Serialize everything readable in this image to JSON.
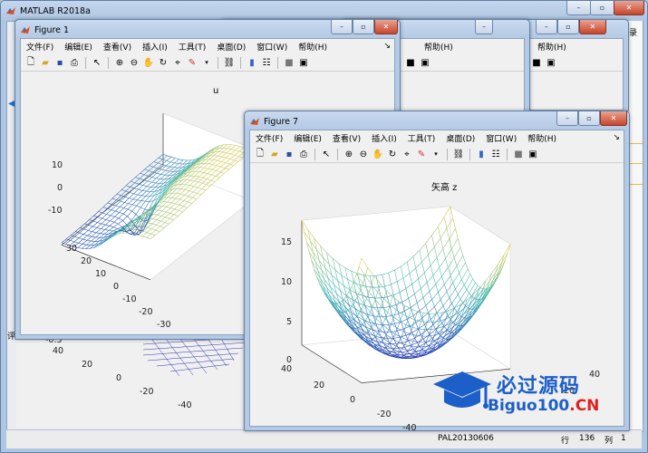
{
  "matlab": {
    "title": "MATLAB R2018a",
    "right_edge_text": "录",
    "status": {
      "pal": "PAL20130606",
      "row_label": "行",
      "row_value": "136",
      "col_label": "列",
      "col_value": "1"
    }
  },
  "bg_figures": {
    "menu_item_help": "帮助(H)"
  },
  "figure1": {
    "title": "Figure 1",
    "menu": [
      "文件(F)",
      "编辑(E)",
      "查看(V)",
      "插入(I)",
      "工具(T)",
      "桌面(D)",
      "窗口(W)",
      "帮助(H)"
    ],
    "plot_title": "u",
    "z_ticks": [
      "10",
      "0",
      "-10"
    ],
    "y_ticks": [
      "30",
      "20",
      "10",
      "0",
      "-10",
      "-20",
      "-30"
    ],
    "x_tick_partial": "-2"
  },
  "behind_plot": {
    "z_ticks": [
      "-0.5"
    ],
    "y_ticks": [
      "40",
      "20",
      "0",
      "-20",
      "-40"
    ],
    "left_edge_text": "评"
  },
  "figure7": {
    "title": "Figure 7",
    "menu": [
      "文件(F)",
      "编辑(E)",
      "查看(V)",
      "插入(I)",
      "工具(T)",
      "桌面(D)",
      "窗口(W)",
      "帮助(H)"
    ],
    "plot_title": "矢高 z",
    "z_ticks": [
      "15",
      "10",
      "5",
      "0"
    ],
    "y_ticks": [
      "40",
      "20",
      "0",
      "-20",
      "-40"
    ],
    "x_ticks": [
      "40",
      "20"
    ]
  },
  "watermark": {
    "cn": "必过源码",
    "url_main": "Biguo100",
    "url_tld": ".CN"
  },
  "colors": {
    "desktop": "#cfdbe9",
    "mesh_low": "#1a2fb4",
    "mesh_mid": "#3fb8b0",
    "mesh_high": "#e8c93a",
    "watermark_blue": "#1d5fc8"
  }
}
